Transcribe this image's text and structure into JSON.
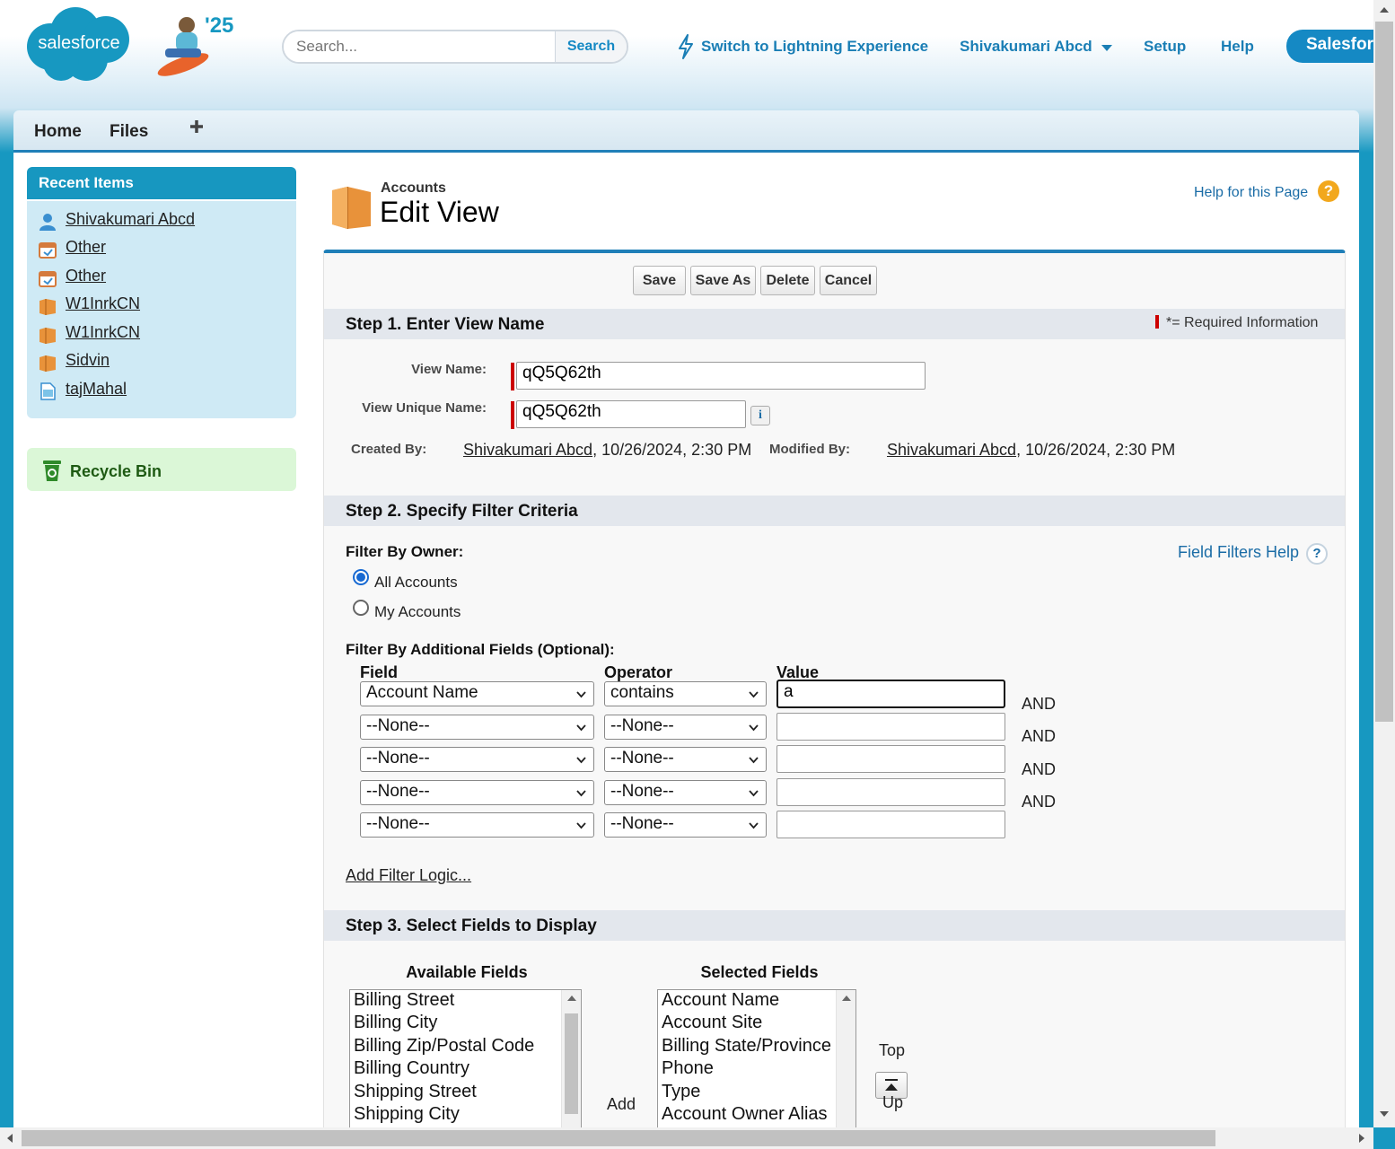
{
  "header": {
    "logo_text": "salesforce",
    "release_badge": "'25",
    "search_placeholder": "Search...",
    "search_button": "Search",
    "lightning_link": "Switch to Lightning Experience",
    "user_menu": "Shivakumari Abcd",
    "setup_link": "Setup",
    "help_link": "Help",
    "app_button": "Salesforce"
  },
  "tabs": [
    {
      "label": "Home"
    },
    {
      "label": "Files"
    }
  ],
  "sidebar": {
    "recent_title": "Recent Items",
    "recent_items": [
      {
        "label": "Shivakumari Abcd",
        "icon": "user-icon"
      },
      {
        "label": "Other",
        "icon": "calendar-icon"
      },
      {
        "label": "Other",
        "icon": "calendar-icon"
      },
      {
        "label": "W1InrkCN",
        "icon": "account-folder-icon"
      },
      {
        "label": "W1InrkCN",
        "icon": "account-folder-icon"
      },
      {
        "label": "Sidvin",
        "icon": "account-folder-icon"
      },
      {
        "label": "tajMahal",
        "icon": "document-icon"
      }
    ],
    "recycle_bin": "Recycle Bin"
  },
  "page": {
    "breadcrumb": "Accounts",
    "title": "Edit View",
    "help_for_page": "Help for this Page"
  },
  "buttons": {
    "save": "Save",
    "save_as": "Save As",
    "delete": "Delete",
    "cancel": "Cancel"
  },
  "step1": {
    "title": "Step 1. Enter View Name",
    "required_note": "*= Required Information",
    "view_name_label": "View Name:",
    "view_name_value": "qQ5Q62th",
    "unique_name_label": "View Unique Name:",
    "unique_name_value": "qQ5Q62th",
    "created_by_label": "Created By:",
    "created_by_user": "Shivakumari Abcd",
    "created_by_date": ", 10/26/2024, 2:30 PM",
    "modified_by_label": "Modified By:",
    "modified_by_user": "Shivakumari Abcd",
    "modified_by_date": ", 10/26/2024, 2:30 PM"
  },
  "step2": {
    "title": "Step 2. Specify Filter Criteria",
    "filter_by_owner": "Filter By Owner:",
    "field_filters_help": "Field Filters Help",
    "owner_options": [
      {
        "label": "All Accounts",
        "selected": true
      },
      {
        "label": "My Accounts",
        "selected": false
      }
    ],
    "additional_fields_label": "Filter By Additional Fields (Optional):",
    "col_field": "Field",
    "col_operator": "Operator",
    "col_value": "Value",
    "filters": [
      {
        "field": "Account Name",
        "operator": "contains",
        "value": "a",
        "conjunction": "AND"
      },
      {
        "field": "--None--",
        "operator": "--None--",
        "value": "",
        "conjunction": "AND"
      },
      {
        "field": "--None--",
        "operator": "--None--",
        "value": "",
        "conjunction": "AND"
      },
      {
        "field": "--None--",
        "operator": "--None--",
        "value": "",
        "conjunction": "AND"
      },
      {
        "field": "--None--",
        "operator": "--None--",
        "value": "",
        "conjunction": ""
      }
    ],
    "add_filter_logic": "Add Filter Logic..."
  },
  "step3": {
    "title": "Step 3. Select Fields to Display",
    "available_label": "Available Fields",
    "selected_label": "Selected Fields",
    "available_fields": [
      "Billing Street",
      "Billing City",
      "Billing Zip/Postal Code",
      "Billing Country",
      "Shipping Street",
      "Shipping City"
    ],
    "selected_fields": [
      "Account Name",
      "Account Site",
      "Billing State/Province",
      "Phone",
      "Type",
      "Account Owner Alias"
    ],
    "add_label": "Add",
    "top_label": "Top",
    "up_label": "Up"
  },
  "colors": {
    "brand_blue": "#1798c1",
    "link_blue": "#1a7eb5",
    "required_red": "#cc0000"
  }
}
